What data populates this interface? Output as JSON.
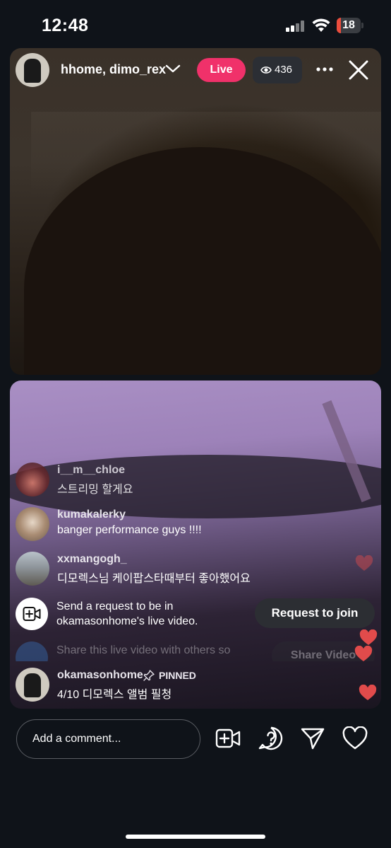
{
  "status_bar": {
    "time": "12:48",
    "battery": "18",
    "battery_level": 0.18,
    "battery_color": "#eb4d3d"
  },
  "header": {
    "host_names": "hhome, dimo_rex",
    "live_label": "Live",
    "viewer_count": "436",
    "live_color": "#f0316a"
  },
  "comments": [
    {
      "username": "i__m__chloe",
      "text": "스트리밍 할게요"
    },
    {
      "username": "kumakalerky",
      "text": "banger performance guys !!!!"
    },
    {
      "username": "xxmangogh_",
      "text": "디모렉스님 케이팝스타때부터 좋아했어요"
    }
  ],
  "request": {
    "line1": "Send a request to be in",
    "line2": "okamasonhome's live video.",
    "button_label": "Request to join"
  },
  "share": {
    "text": "Share this live video with others so",
    "button_label": "Share Video"
  },
  "pinned": {
    "username": "okamasonhome",
    "tag": "PINNED",
    "text": "4/10 디모렉스 앨범 필청"
  },
  "bottom_bar": {
    "comment_placeholder": "Add a comment...",
    "icons": [
      "add-video-icon",
      "question-icon",
      "send-icon",
      "heart-icon"
    ]
  }
}
